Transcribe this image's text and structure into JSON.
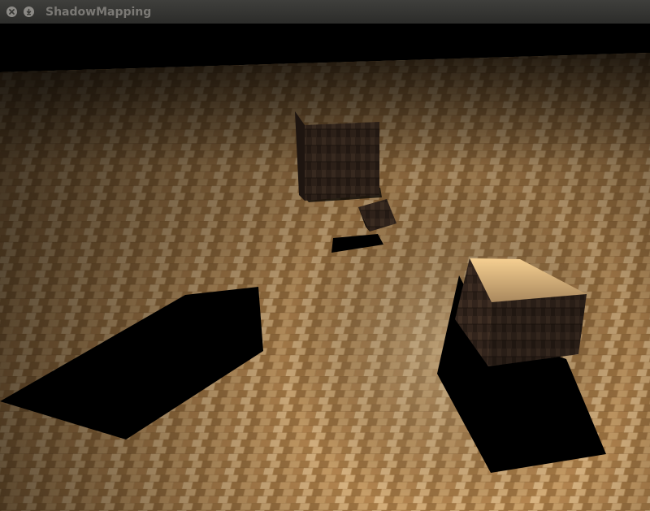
{
  "window": {
    "title": "ShadowMapping",
    "controls": [
      "close-icon",
      "minimize-icon"
    ]
  },
  "scene": {
    "type": "3d-render",
    "floor": "wood-parquet",
    "objects": [
      "cube",
      "cube",
      "cube"
    ],
    "shadows": 3
  },
  "colors": {
    "titlebar": "#3a3a37",
    "title_text": "#7b7975",
    "floor_light": "#d9b27a",
    "floor_dark": "#3a2713",
    "cube_wood": "#3b2a20",
    "shadow": "#000000"
  }
}
